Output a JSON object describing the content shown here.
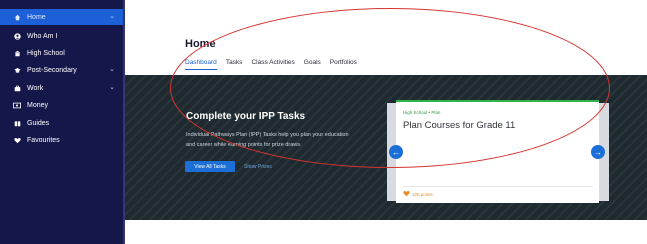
{
  "sidebar": {
    "items": [
      {
        "label": "Home",
        "icon": "home-icon",
        "active": true,
        "chevron": true
      },
      {
        "label": "Who Am I",
        "icon": "user-icon",
        "active": false,
        "chevron": false
      },
      {
        "label": "High School",
        "icon": "school-icon",
        "active": false,
        "chevron": false
      },
      {
        "label": "Post-Secondary",
        "icon": "graduation-icon",
        "active": false,
        "chevron": true
      },
      {
        "label": "Work",
        "icon": "briefcase-icon",
        "active": false,
        "chevron": true
      },
      {
        "label": "Money",
        "icon": "money-icon",
        "active": false,
        "chevron": false
      },
      {
        "label": "Guides",
        "icon": "book-icon",
        "active": false,
        "chevron": false
      },
      {
        "label": "Favourites",
        "icon": "heart-icon",
        "active": false,
        "chevron": false
      }
    ]
  },
  "header": {
    "title": "Home",
    "tabs": [
      "Dashboard",
      "Tasks",
      "Class Activities",
      "Goals",
      "Portfolios"
    ]
  },
  "banner": {
    "title": "Complete your IPP Tasks",
    "text": "Individual Pathways Plan (IPP) Tasks help you plan your education and career while earning points for prize draws.",
    "view_button": "View All Tasks",
    "prizes_link": "Show Prizes"
  },
  "card": {
    "crumb": "High School • Plan",
    "title": "Plan Courses for Grade 11",
    "points": "100 points"
  },
  "colors": {
    "sidebar_bg": "#15174a",
    "active_item": "#1c5fd6",
    "accent_green": "#2db34a",
    "points_orange": "#e48b2a",
    "annotation_red": "#d6342f"
  }
}
